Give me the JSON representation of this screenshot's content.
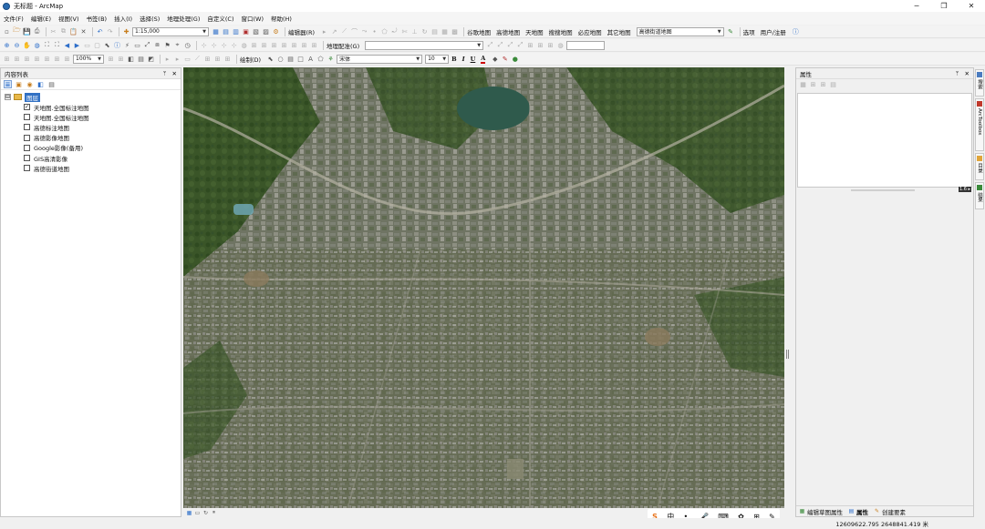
{
  "window": {
    "title": "无标题 - ArcMap",
    "minimize": "─",
    "maximize": "❐",
    "close": "✕"
  },
  "menu": [
    "文件(F)",
    "编辑(E)",
    "视图(V)",
    "书签(B)",
    "插入(I)",
    "选择(S)",
    "地理处理(G)",
    "自定义(C)",
    "窗口(W)",
    "帮助(H)"
  ],
  "toolbar1": {
    "scale": "1:15,000",
    "editor_label": "编辑器(R)",
    "map_sources": [
      "谷歌地图",
      "高德地图",
      "天地图",
      "搜搜地图",
      "必应地图",
      "其它地图"
    ],
    "selected_map": "高德街道地图",
    "options_label": "选项",
    "user_label": "用户/注册"
  },
  "toolbar2": {
    "zoom": "100%",
    "georef_label": "地理配准(G)"
  },
  "toolbar3": {
    "draw_label": "绘制(D)",
    "font_name": "宋体",
    "font_size": "10",
    "bold": "B",
    "italic": "I",
    "underline": "U",
    "text_tool": "A"
  },
  "toc": {
    "title": "内容列表",
    "pin": "ᛘ",
    "close": "✕",
    "group_name": "图层",
    "layers": [
      {
        "name": "天地图.全国标注地图",
        "checked": true
      },
      {
        "name": "天地图.全国标注地图",
        "checked": false
      },
      {
        "name": "高德标注地图",
        "checked": false
      },
      {
        "name": "高德影像地图",
        "checked": false
      },
      {
        "name": "Google影像(备用)",
        "checked": false
      },
      {
        "name": "GIS高清影像",
        "checked": false
      },
      {
        "name": "高德街道地图",
        "checked": false
      }
    ],
    "expander": "⊟",
    "check_mark": "✓"
  },
  "properties": {
    "title": "属性",
    "tabs": [
      "编辑草图属性",
      "属性",
      "创建要素"
    ],
    "badge": "1.6 ▸"
  },
  "side_tabs": [
    "搜索",
    "ArcToolbox",
    "目录",
    "结果"
  ],
  "ime": {
    "logo": "S",
    "mode": "中",
    "items": [
      "•,",
      "🎤",
      "⌨",
      "✿",
      "⊞",
      "✎"
    ]
  },
  "status": {
    "coords": "12609622.795   2648841.419 米"
  },
  "colors": {
    "accent": "#3271c4",
    "map_base": "#55614a",
    "vegetation": "#3d5a2a",
    "urban": "#8a8a80",
    "lake": "#2f5a4c"
  },
  "icons": {
    "new": "▫",
    "open": "🗁",
    "save": "💾",
    "print": "⎙",
    "cut": "✂",
    "copy": "⧉",
    "paste": "📋",
    "delete": "✕",
    "undo": "↶",
    "redo": "↷",
    "add_data": "✚",
    "zoom_in": "⊕",
    "zoom_out": "⊖",
    "pan": "✋",
    "globe": "◍",
    "back": "◀",
    "forward": "▶",
    "select": "⬉",
    "info": "ⓘ",
    "measure": "⤢",
    "binoculars": "⧈",
    "pointer": "⬉",
    "rectangle": "□",
    "circle": "○"
  }
}
